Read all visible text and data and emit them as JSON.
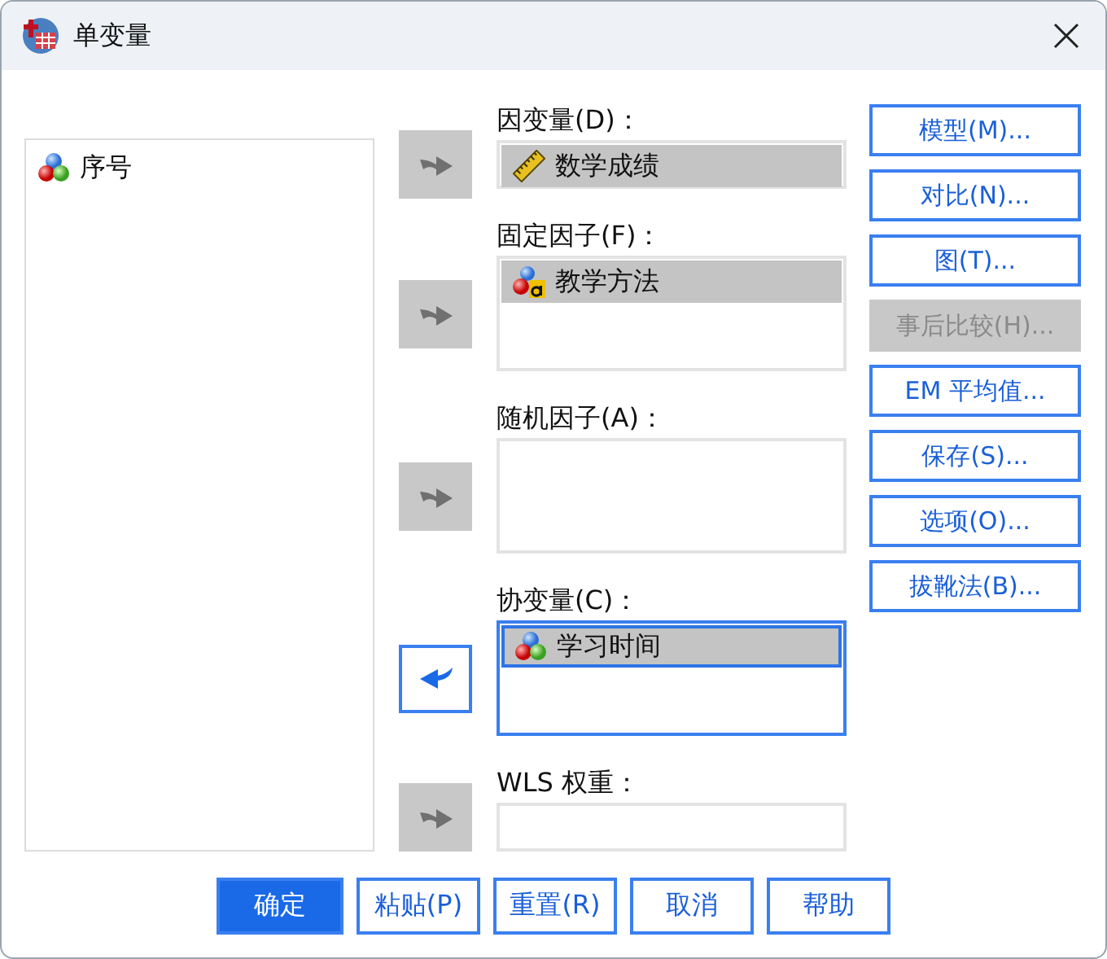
{
  "window": {
    "title": "单变量"
  },
  "source_list": {
    "variables": [
      {
        "name": "序号",
        "kind": "nominal",
        "selected": false
      }
    ]
  },
  "target_fields": [
    {
      "label": "因变量(D)：",
      "kind": "single",
      "focused": false,
      "arrow": {
        "points_left": false,
        "disabled": true
      },
      "variables": [
        {
          "name": "数学成绩",
          "kind": "scale",
          "selected": true
        }
      ]
    },
    {
      "label": "固定因子(F)：",
      "kind": "list",
      "focused": false,
      "arrow": {
        "points_left": false,
        "disabled": true
      },
      "variables": [
        {
          "name": "教学方法",
          "kind": "string",
          "selected": true
        }
      ]
    },
    {
      "label": "随机因子(A)：",
      "kind": "list",
      "focused": false,
      "arrow": {
        "points_left": false,
        "disabled": true
      }
    },
    {
      "label": "协变量(C)：",
      "kind": "list",
      "focused": true,
      "arrow": {
        "points_left": true,
        "disabled": false
      },
      "variables": [
        {
          "name": "学习时间",
          "kind": "nominal",
          "selected": true
        }
      ]
    },
    {
      "label": "WLS 权重：",
      "kind": "single",
      "focused": false,
      "arrow": {
        "points_left": false,
        "disabled": true
      }
    }
  ],
  "side_buttons": [
    {
      "label": "模型(M)...",
      "disabled": false
    },
    {
      "label": "对比(N)...",
      "disabled": false
    },
    {
      "label": "图(T)...",
      "disabled": false
    },
    {
      "label": "事后比较(H)...",
      "disabled": true
    },
    {
      "label": "EM 平均值...",
      "disabled": false
    },
    {
      "label": "保存(S)...",
      "disabled": false
    },
    {
      "label": "选项(O)...",
      "disabled": false
    },
    {
      "label": "拔靴法(B)...",
      "disabled": false
    }
  ],
  "bottom_buttons": [
    {
      "label": "确定",
      "primary": true
    },
    {
      "label": "粘贴(P)",
      "primary": false
    },
    {
      "label": "重置(R)",
      "primary": false
    },
    {
      "label": "取消",
      "primary": false
    },
    {
      "label": "帮助",
      "primary": false
    }
  ]
}
